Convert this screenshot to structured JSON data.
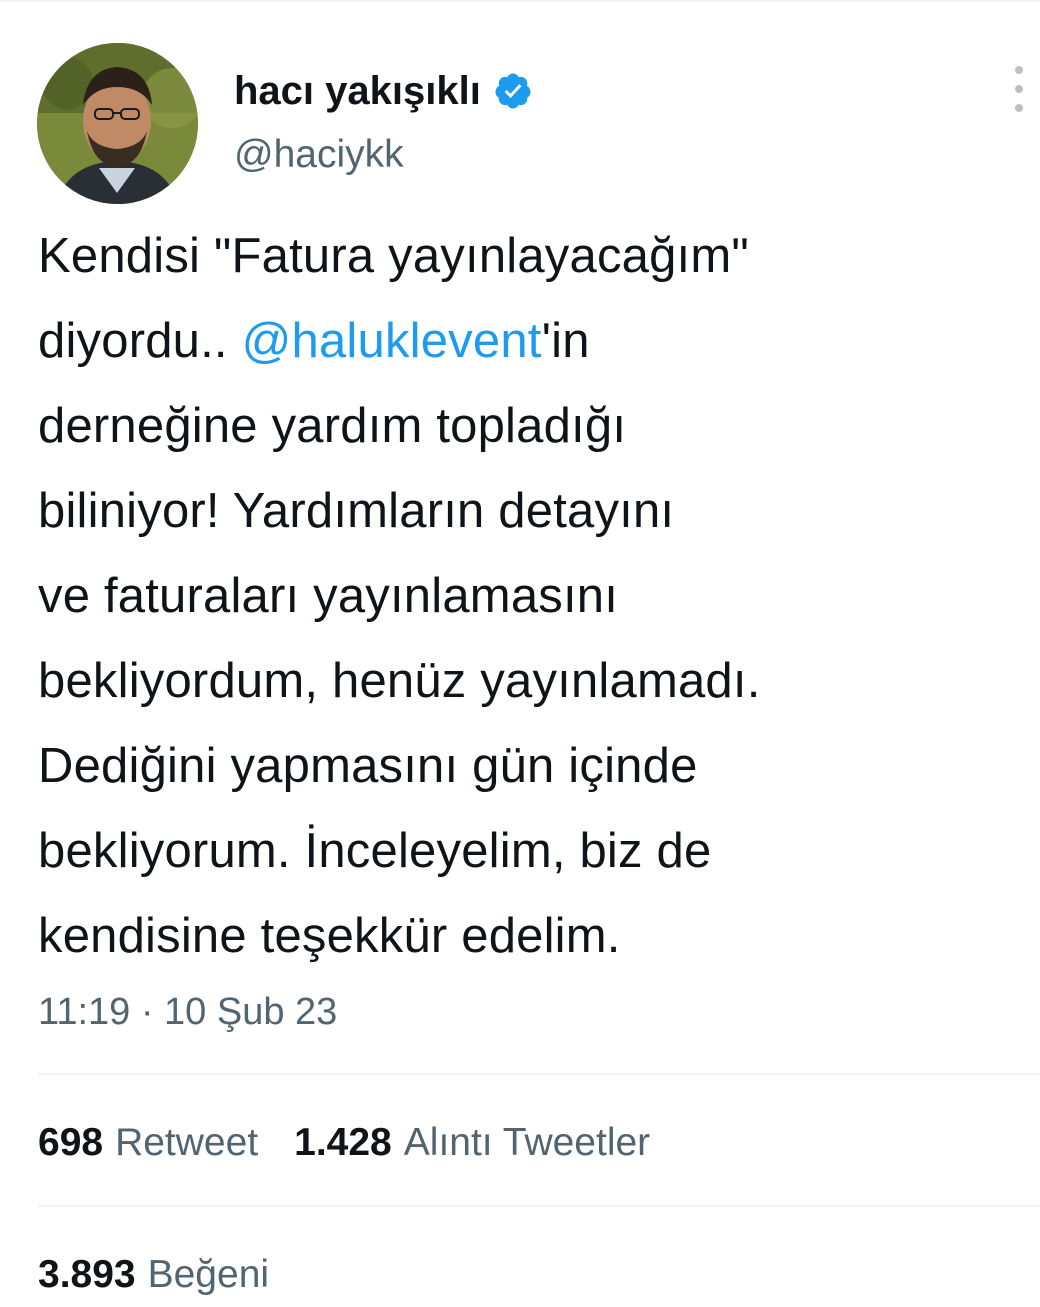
{
  "tweet": {
    "author": {
      "display_name": "hacı yakışıklı",
      "handle": "@haciykk",
      "verified": true
    },
    "text_lines": [
      [
        {
          "t": "Kendisi \"Fatura yayınlayacağım\""
        }
      ],
      [
        {
          "t": "diyordu.. "
        },
        {
          "t": "@haluklevent",
          "mention": true
        },
        {
          "t": "'in"
        }
      ],
      [
        {
          "t": "derneğine yardım topladığı"
        }
      ],
      [
        {
          "t": "biliniyor! Yardımların detayını"
        }
      ],
      [
        {
          "t": "ve faturaları yayınlamasını"
        }
      ],
      [
        {
          "t": "bekliyordum, henüz yayınlamadı."
        }
      ],
      [
        {
          "t": "Dediğini yapmasını gün içinde"
        }
      ],
      [
        {
          "t": "bekliyorum. İnceleyelim, biz de"
        }
      ],
      [
        {
          "t": "kendisine teşekkür edelim."
        }
      ]
    ],
    "timestamp": "11:19 · 10 Şub 23",
    "stats": {
      "retweets": {
        "count": "698",
        "label": "Retweet"
      },
      "quotes": {
        "count": "1.428",
        "label": "Alıntı Tweetler"
      },
      "likes": {
        "count": "3.893",
        "label": "Beğeni"
      }
    }
  },
  "colors": {
    "text": "#0f1419",
    "secondary": "#536471",
    "mention": "#1d9bf0",
    "verified": "#1d9bf0",
    "divider": "#eff3f4"
  },
  "icons": {
    "verified": "verified-badge-icon",
    "more": "more-vertical-icon"
  }
}
